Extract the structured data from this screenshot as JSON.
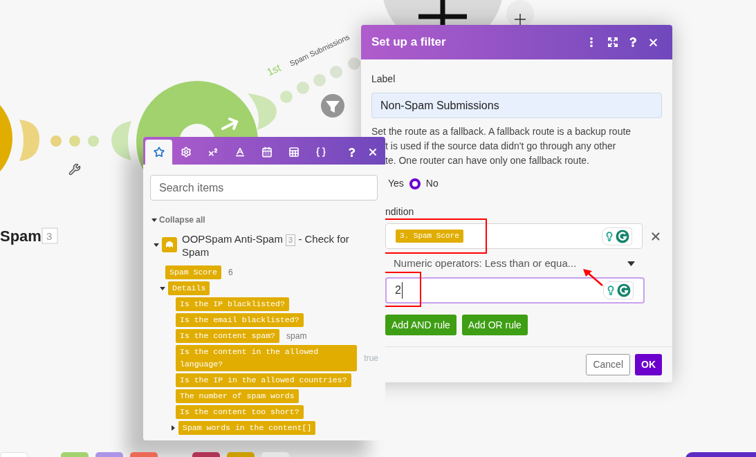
{
  "canvas": {
    "module": {
      "label": "Spam",
      "badge": "3"
    },
    "route": {
      "order": "1st",
      "label": "Spam Submissions"
    }
  },
  "filter_dialog": {
    "title": "Set up a filter",
    "label_field": {
      "label": "Label",
      "value": "Non-Spam Submissions"
    },
    "fallback_text": [
      "Set the route as a fallback. A fallback route is a backup route",
      "t is used if the source data didn't go through any other",
      "te. One router can have only one fallback route."
    ],
    "fallback_options": [
      {
        "label": "Yes",
        "selected": false
      },
      {
        "label": "No",
        "selected": true
      }
    ],
    "condition": {
      "label": "ndition",
      "operand": "3. Spam Score",
      "operator": "Numeric operators: Less than or equa...",
      "value": "2"
    },
    "rule_buttons": [
      "Add AND rule",
      "Add OR rule"
    ],
    "footer_buttons": [
      {
        "label": "Cancel",
        "kind": "secondary"
      },
      {
        "label": "OK",
        "kind": "primary"
      }
    ]
  },
  "mapping_panel": {
    "tabs": [
      {
        "kind": "star",
        "selected": true
      },
      {
        "kind": "gear",
        "selected": false
      },
      {
        "kind": "superscript",
        "selected": false
      },
      {
        "kind": "text",
        "selected": false
      },
      {
        "kind": "calendar",
        "selected": false
      },
      {
        "kind": "table",
        "selected": false
      },
      {
        "kind": "braces",
        "selected": false
      }
    ],
    "search": {
      "placeholder": "Search items"
    },
    "collapse_all": "Collapse all",
    "module": {
      "title": "OOPSpam Anti-Spam",
      "badge": "3",
      "subtitle": "- Check for Spam",
      "expanded": true,
      "items": [
        {
          "label": "Spam Score",
          "value": "6"
        },
        {
          "label": "Details",
          "expanded": true,
          "children": [
            {
              "label": "Is the IP blacklisted?"
            },
            {
              "label": "Is the email blacklisted?"
            },
            {
              "label": "Is the content spam?",
              "value": "spam"
            },
            {
              "label": "Is the content in the allowed language?",
              "value": "true",
              "faded": true
            },
            {
              "label": "Is the IP in the allowed countries?"
            },
            {
              "label": "The number of spam words"
            },
            {
              "label": "Is the content too short?"
            },
            {
              "label": "Spam words in the content[]",
              "expanded": false
            }
          ]
        }
      ]
    }
  },
  "bottom_toolbar": [
    {
      "color": "#ffffff"
    },
    {
      "color": "#a3d36f"
    },
    {
      "color": "#ac95e6"
    },
    {
      "color": "#ec6a55"
    },
    {
      "color": "#b03455"
    },
    {
      "color": "#cc9e00"
    },
    {
      "color": "#e6e6e6"
    }
  ]
}
